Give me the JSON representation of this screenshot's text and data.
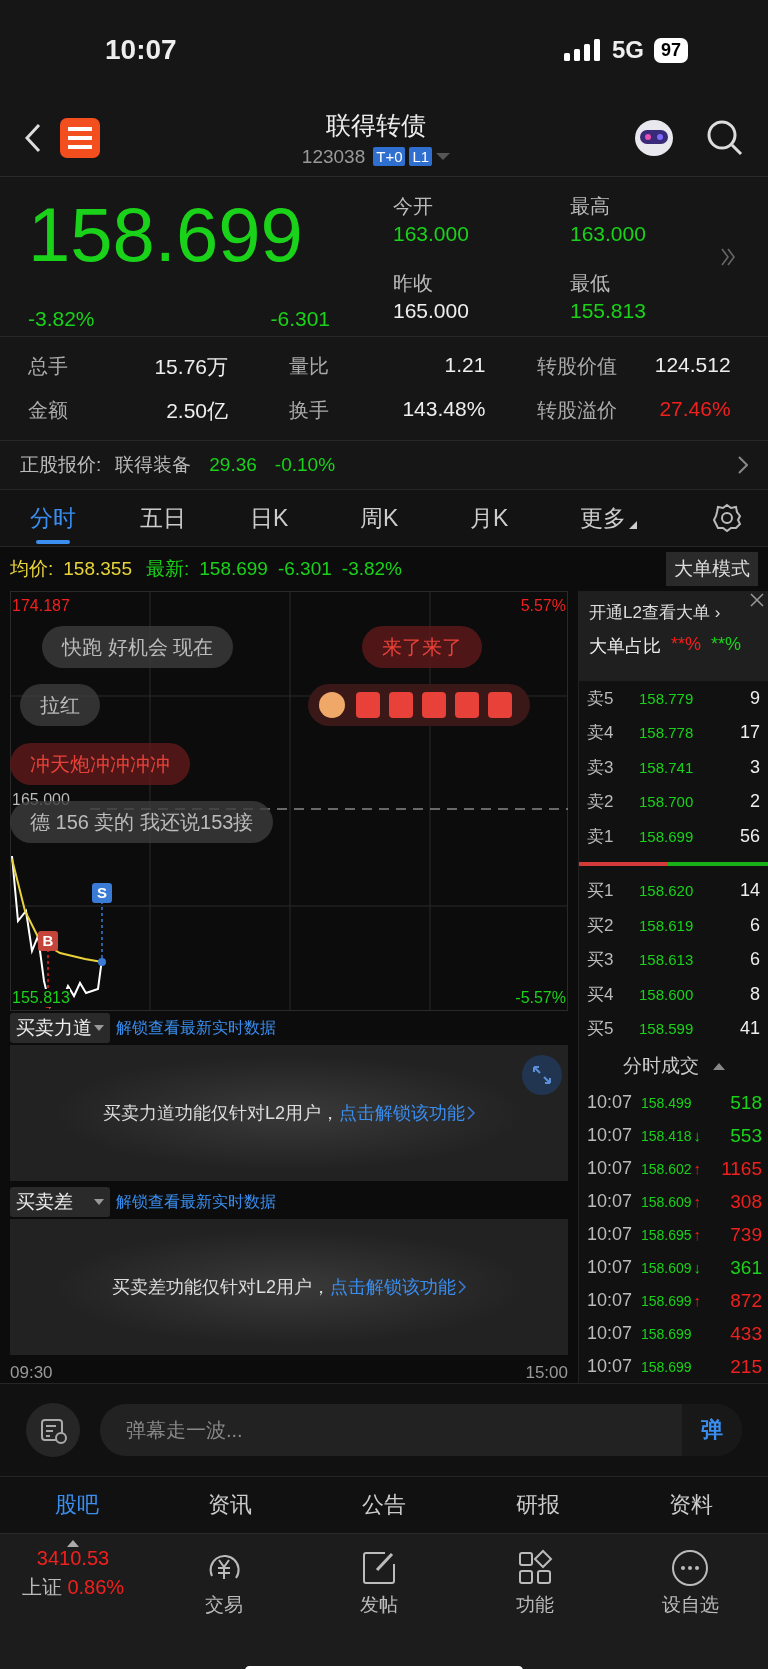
{
  "status_bar": {
    "time": "10:07",
    "network": "5G",
    "battery": "97"
  },
  "header": {
    "title": "联得转债",
    "code": "123038",
    "badges": [
      "T+0",
      "L1"
    ]
  },
  "quote": {
    "price": "158.699",
    "change_pct": "-3.82%",
    "change": "-6.301",
    "fields": [
      {
        "label": "今开",
        "value": "163.000",
        "color": "#19d219"
      },
      {
        "label": "最高",
        "value": "163.000",
        "color": "#19d219"
      },
      {
        "label": "昨收",
        "value": "165.000",
        "color": "#eeeeee"
      },
      {
        "label": "最低",
        "value": "155.813",
        "color": "#19d219"
      }
    ]
  },
  "stats": [
    {
      "label": "总手",
      "value": "15.76万",
      "color": "#eeeeee"
    },
    {
      "label": "量比",
      "value": "1.21",
      "color": "#eeeeee"
    },
    {
      "label": "转股价值",
      "value": "124.512",
      "color": "#eeeeee"
    },
    {
      "label": "金额",
      "value": "2.50亿",
      "color": "#eeeeee"
    },
    {
      "label": "换手",
      "value": "143.48%",
      "color": "#eeeeee"
    },
    {
      "label": "转股溢价",
      "value": "27.46%",
      "color": "#f0201e"
    }
  ],
  "stock_quote": {
    "label": "正股报价:",
    "name": "联得装备",
    "price": "29.36",
    "change": "-0.10%"
  },
  "tabs": [
    {
      "label": "分时",
      "selected": true,
      "kind": "plain"
    },
    {
      "label": "五日",
      "selected": false,
      "kind": "plain"
    },
    {
      "label": "日K",
      "selected": false,
      "kind": "plain"
    },
    {
      "label": "周K",
      "selected": false,
      "kind": "plain"
    },
    {
      "label": "月K",
      "selected": false,
      "kind": "plain"
    },
    {
      "label": "更多",
      "selected": false,
      "kind": "menu"
    }
  ],
  "chart_info": {
    "avg_label": "均价:",
    "avg": "158.355",
    "last_label": "最新:",
    "last": "158.699",
    "change": "-6.301",
    "change_pct": "-3.82%",
    "mode_button": "大单模式"
  },
  "chart": {
    "high": "174.187",
    "high_pct": "5.57%",
    "prev_close": "165.000",
    "low": "155.813",
    "low_pct": "-5.57%",
    "sell_marker": "S",
    "buy_marker": "B",
    "start_time": "09:30",
    "end_time": "15:00"
  },
  "danmaku": [
    {
      "text": "快跑 好机会 现在",
      "kind": "grey"
    },
    {
      "text": "来了来了",
      "kind": "red"
    },
    {
      "text": "拉红",
      "kind": "grey"
    },
    {
      "kind": "sticker"
    },
    {
      "text": "冲天炮冲冲冲冲",
      "kind": "red"
    },
    {
      "text": "德 156 卖的  我还说153接",
      "kind": "grey"
    }
  ],
  "indicators": [
    {
      "name": "买卖力道",
      "link": "解锁查看最新实时数据",
      "message": "买卖力道功能仅针对L2用户，",
      "action": "点击解锁该功能"
    },
    {
      "name": "买卖差",
      "link": "解锁查看最新实时数据",
      "message": "买卖差功能仅针对L2用户，",
      "action": "点击解锁该功能"
    }
  ],
  "order_panel": {
    "promo": "开通L2查看大单 ›",
    "ratio_label": "大单占比",
    "buy_ratio": "**%",
    "sell_ratio": "**%"
  },
  "asks": [
    {
      "label": "卖5",
      "price": "158.779",
      "volume": "9"
    },
    {
      "label": "卖4",
      "price": "158.778",
      "volume": "17"
    },
    {
      "label": "卖3",
      "price": "158.741",
      "volume": "3"
    },
    {
      "label": "卖2",
      "price": "158.700",
      "volume": "2"
    },
    {
      "label": "卖1",
      "price": "158.699",
      "volume": "56"
    }
  ],
  "ratio_bar": {
    "level": 0.47
  },
  "bids": [
    {
      "label": "买1",
      "price": "158.620",
      "volume": "14"
    },
    {
      "label": "买2",
      "price": "158.619",
      "volume": "6"
    },
    {
      "label": "买3",
      "price": "158.613",
      "volume": "6"
    },
    {
      "label": "买4",
      "price": "158.600",
      "volume": "8"
    },
    {
      "label": "买5",
      "price": "158.599",
      "volume": "41"
    }
  ],
  "trades_title": "分时成交",
  "trades": [
    {
      "time": "10:07",
      "price": "158.499",
      "volume": "518",
      "color": "#19d219"
    },
    {
      "time": "10:07",
      "price": "158.418",
      "arrow": "↓",
      "volume": "553",
      "color": "#19d219"
    },
    {
      "time": "10:07",
      "price": "158.602",
      "arrow": "↑",
      "volume": "1165",
      "color": "#f0201e"
    },
    {
      "time": "10:07",
      "price": "158.609",
      "arrow": "↑",
      "volume": "308",
      "color": "#f0201e"
    },
    {
      "time": "10:07",
      "price": "158.695",
      "arrow": "↑",
      "volume": "739",
      "color": "#f0201e"
    },
    {
      "time": "10:07",
      "price": "158.609",
      "arrow": "↓",
      "volume": "361",
      "color": "#19d219"
    },
    {
      "time": "10:07",
      "price": "158.699",
      "arrow": "↑",
      "volume": "872",
      "color": "#f0201e"
    },
    {
      "time": "10:07",
      "price": "158.699",
      "volume": "433",
      "color": "#f0201e"
    },
    {
      "time": "10:07",
      "price": "158.699",
      "volume": "215",
      "color": "#f0201e"
    }
  ],
  "comment_box": {
    "placeholder": "弹幕走一波...",
    "send": "弹"
  },
  "section_tabs": [
    {
      "label": "股吧",
      "selected": true
    },
    {
      "label": "资讯",
      "selected": false
    },
    {
      "label": "公告",
      "selected": false
    },
    {
      "label": "研报",
      "selected": false
    },
    {
      "label": "资料",
      "selected": false
    }
  ],
  "market": {
    "value": "3410.53",
    "name": "上证",
    "change": "0.86%",
    "color": "#f0201e"
  },
  "nav": [
    {
      "label": "交易",
      "kind": "trade"
    },
    {
      "label": "发帖",
      "kind": "post"
    },
    {
      "label": "功能",
      "kind": "apps"
    },
    {
      "label": "设自选",
      "kind": "more"
    }
  ]
}
